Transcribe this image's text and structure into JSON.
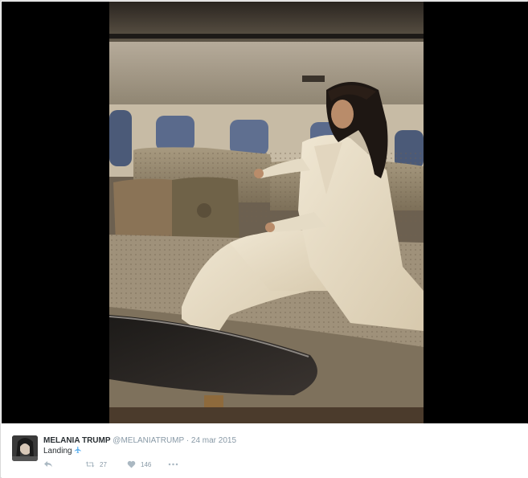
{
  "media": {
    "kind": "photo",
    "background_color": "#000000"
  },
  "tweet": {
    "author_name": "MELANIA TRUMP",
    "author_handle": "@MELANIATRUMP",
    "separator": "·",
    "date": "24 mar 2015",
    "text": "Landing",
    "emoji": "airplane-icon",
    "actions": {
      "reply_icon": "reply-icon",
      "retweet_icon": "retweet-icon",
      "retweet_count": "27",
      "like_icon": "heart-icon",
      "like_count": "146",
      "more_icon": "more-icon"
    },
    "colors": {
      "name": "#292f33",
      "meta": "#8899a6",
      "accent": "#55acee"
    }
  }
}
